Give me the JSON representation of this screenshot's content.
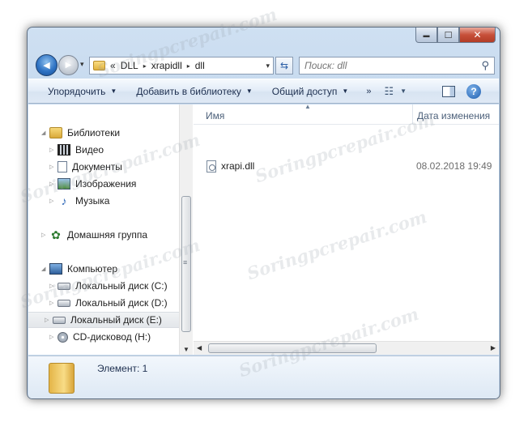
{
  "window": {
    "caption": {
      "minimize": "▬",
      "maximize": "☐",
      "close": "✕"
    }
  },
  "navbar": {
    "back": "◀",
    "forward": "▶",
    "recent": "▾",
    "address": {
      "prefix": "«",
      "segments": [
        "DLL",
        "xrapidll",
        "dll"
      ],
      "separator": "▸",
      "dropdown": "▾"
    },
    "refresh": "⇆",
    "search": {
      "placeholder": "Поиск: dll",
      "icon": "⚲"
    }
  },
  "toolbar": {
    "organize": "Упорядочить",
    "add_to_library": "Добавить в библиотеку",
    "share": "Общий доступ",
    "more": "»",
    "views_icon": "☷",
    "help": "?",
    "dropdown_arrow": "▼"
  },
  "navpane": {
    "items": [
      {
        "label": "Библиотеки",
        "icon": "library-icon"
      },
      {
        "label": "Видео",
        "icon": "video-icon"
      },
      {
        "label": "Документы",
        "icon": "documents-icon"
      },
      {
        "label": "Изображения",
        "icon": "pictures-icon"
      },
      {
        "label": "Музыка",
        "icon": "music-icon"
      },
      {
        "label": "Домашняя группа",
        "icon": "homegroup-icon"
      },
      {
        "label": "Компьютер",
        "icon": "computer-icon"
      },
      {
        "label": "Локальный диск (C:)",
        "icon": "drive-icon"
      },
      {
        "label": "Локальный диск (D:)",
        "icon": "drive-icon"
      },
      {
        "label": "Локальный диск (E:)",
        "icon": "drive-icon",
        "selected": true
      },
      {
        "label": "CD-дисковод (H:)",
        "icon": "cd-drive-icon"
      }
    ],
    "music_glyph": "♪",
    "home_glyph": "✿",
    "expander": "▷",
    "expander_open": "◢",
    "scroll_grip": "≡",
    "scroll_down": "▼"
  },
  "filelist": {
    "columns": {
      "name": "Имя",
      "date": "Дата изменения"
    },
    "sort_arrow": "▲",
    "files": [
      {
        "name": "xrapi.dll",
        "date": "08.02.2018 19:49",
        "icon": "dll-file-icon"
      }
    ],
    "scroll_left": "◀",
    "scroll_right": "▶"
  },
  "details": {
    "text": "Элемент: 1",
    "icon": "folder-icon"
  },
  "watermark": "Soringpcrepair.com"
}
